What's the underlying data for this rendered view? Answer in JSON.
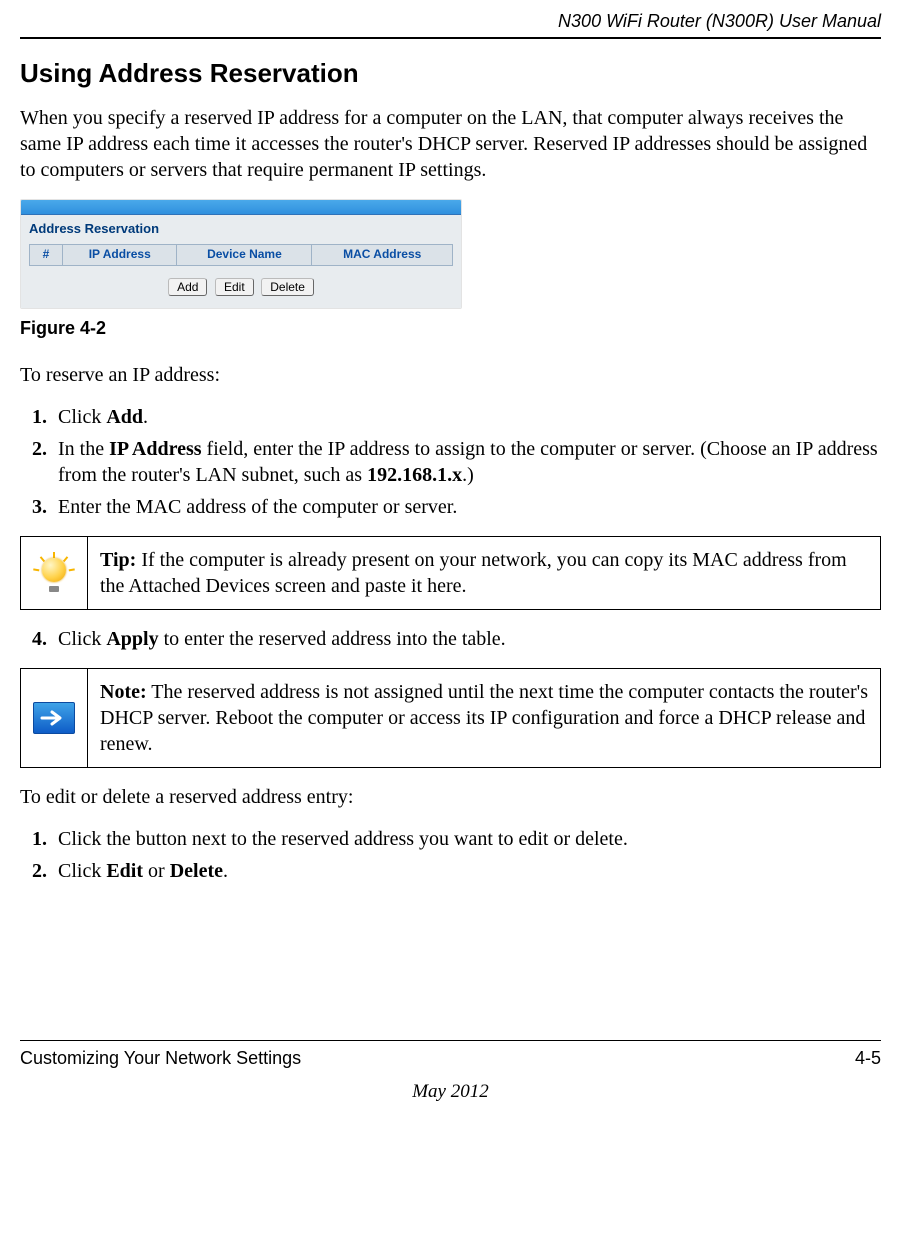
{
  "header": {
    "title": "N300 WiFi Router (N300R) User Manual"
  },
  "section": {
    "heading": "Using Address Reservation"
  },
  "intro": "When you specify a reserved IP address for a computer on the LAN, that computer always receives the same IP address each time it accesses the router's DHCP server. Reserved IP addresses should be assigned to computers or servers that require permanent IP settings.",
  "figure": {
    "panelTitle": "Address Reservation",
    "columns": {
      "hash": "#",
      "ip": "IP Address",
      "device": "Device Name",
      "mac": "MAC Address"
    },
    "buttons": {
      "add": "Add",
      "edit": "Edit",
      "delete": "Delete"
    },
    "caption": "Figure 4-2"
  },
  "reserveIntro": "To reserve an IP address:",
  "steps1": {
    "s1a": "Click ",
    "s1b": "Add",
    "s1c": ".",
    "s2a": "In the ",
    "s2b": "IP Address",
    "s2c": " field, enter the IP address to assign to the computer or server. (Choose an IP address from the router's LAN subnet, such as ",
    "s2d": "192.168.1.x",
    "s2e": ".)",
    "s3": "Enter the MAC address of the computer or server."
  },
  "tip": {
    "label": "Tip:",
    "text": " If the computer is already present on your network, you can copy its MAC address from the Attached Devices screen and paste it here."
  },
  "step4": {
    "a": "Click ",
    "b": "Apply",
    "c": " to enter the reserved address into the table."
  },
  "note": {
    "label": "Note:",
    "text": " The reserved address is not assigned until the next time the computer contacts the router's DHCP server. Reboot the computer or access its IP configuration and force a DHCP release and renew."
  },
  "editIntro": "To edit or delete a reserved address entry:",
  "steps2": {
    "s1": "Click the button next to the reserved address you want to edit or delete.",
    "s2a": "Click ",
    "s2b": "Edit",
    "s2c": " or ",
    "s2d": "Delete",
    "s2e": "."
  },
  "footer": {
    "left": "Customizing Your Network Settings",
    "right": "4-5",
    "date": "May 2012"
  }
}
